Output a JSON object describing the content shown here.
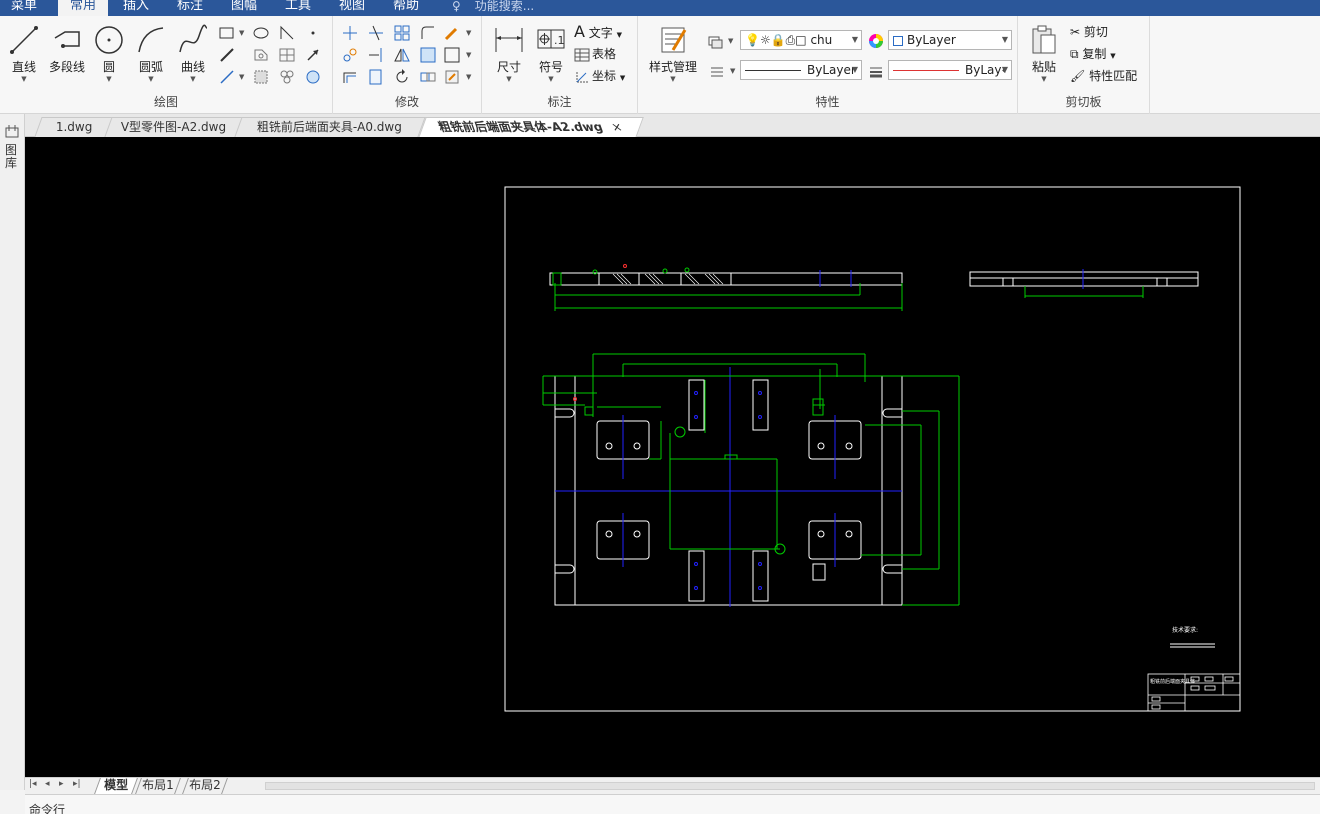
{
  "menu": {
    "tabs": [
      {
        "label": "菜单",
        "active": false
      },
      {
        "label": "常用",
        "active": true
      },
      {
        "label": "插入",
        "active": false
      },
      {
        "label": "标注",
        "active": false
      },
      {
        "label": "图幅",
        "active": false
      },
      {
        "label": "工具",
        "active": false
      },
      {
        "label": "视图",
        "active": false
      },
      {
        "label": "帮助",
        "active": false
      }
    ],
    "search_placeholder": "功能搜索..."
  },
  "ribbon": {
    "draw": {
      "label": "绘图",
      "tools": [
        "直线",
        "多段线",
        "圆",
        "圆弧",
        "曲线"
      ]
    },
    "modify": {
      "label": "修改"
    },
    "annotate": {
      "label": "标注",
      "tools": [
        "尺寸",
        "符号"
      ],
      "side": [
        "文字",
        "表格",
        "坐标"
      ]
    },
    "properties": {
      "label": "特性",
      "style_manager": "样式管理",
      "layer_value": "chu",
      "color_value": "ByLayer",
      "linetype_value": "ByLayer",
      "lineweight_value": "ByLay‹"
    },
    "clipboard": {
      "label": "剪切板",
      "paste": "粘贴",
      "cut": "剪切",
      "copy": "复制",
      "match": "特性匹配"
    }
  },
  "doc_tabs": [
    {
      "label": "1.dwg",
      "active": false
    },
    {
      "label": "V型零件图-A2.dwg",
      "active": false
    },
    {
      "label": "粗铣前后端面夹具-A0.dwg",
      "active": false
    },
    {
      "label": "粗铣前后端面夹具体-A2.dwg",
      "active": true
    }
  ],
  "doc_tab_close": "×",
  "side_panel_label": "图库",
  "drawing": {
    "tech_requirements": "技术要求:",
    "title_block_text": "粗铣前后端面夹具体",
    "colors": {
      "background": "#000000",
      "outline": "#ffffff",
      "dimension": "#00cc00",
      "centerline": "#2222ff",
      "accent": "#ff3030"
    }
  },
  "layout_tabs": [
    {
      "label": "模型",
      "active": true
    },
    {
      "label": "布局1",
      "active": false
    },
    {
      "label": "布局2",
      "active": false
    }
  ],
  "command_line_label": "命令行"
}
